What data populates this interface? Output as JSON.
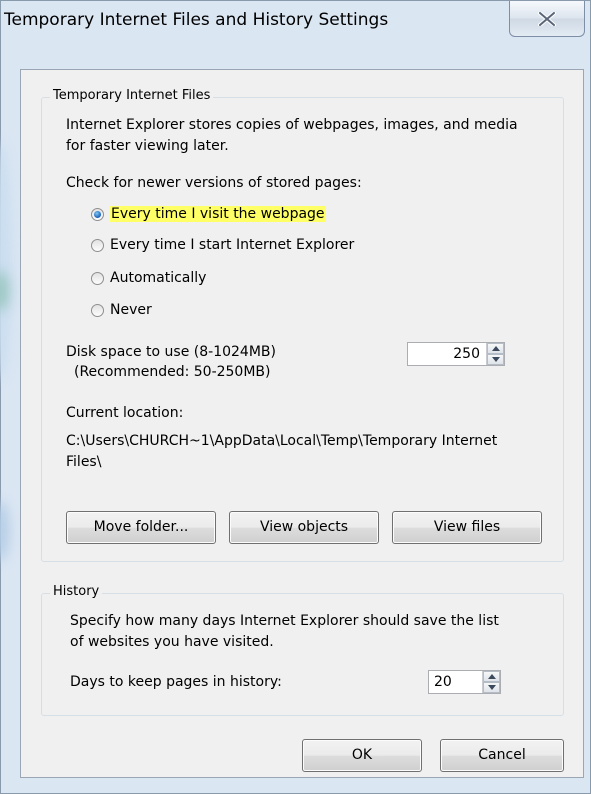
{
  "window": {
    "title": "Temporary Internet Files and History Settings"
  },
  "icons": {
    "close": "close-x-icon",
    "spin_up": "arrow-up-icon",
    "spin_down": "arrow-down-icon"
  },
  "colors": {
    "highlight": "#ffff66",
    "radio_selected": "#1a5fb4"
  },
  "temp_files": {
    "group_title": "Temporary Internet Files",
    "description_line1": "Internet Explorer stores copies of webpages, images, and media",
    "description_line2": "for faster viewing later.",
    "check_label": "Check for newer versions of stored pages:",
    "options": [
      {
        "label": "Every time I visit the webpage",
        "selected": true
      },
      {
        "label": "Every time I start Internet Explorer",
        "selected": false
      },
      {
        "label": "Automatically",
        "selected": false
      },
      {
        "label": "Never",
        "selected": false
      }
    ],
    "disk_label_line1": "Disk space to use (8-1024MB)",
    "disk_label_line2": "(Recommended: 50-250MB)",
    "disk_value": "250",
    "location_label": "Current location:",
    "location_path_line1": "C:\\Users\\CHURCH~1\\AppData\\Local\\Temp\\Temporary Internet",
    "location_path_line2": "Files\\",
    "buttons": {
      "move": "Move folder...",
      "objects": "View objects",
      "files": "View files"
    }
  },
  "history": {
    "group_title": "History",
    "description_line1": "Specify how many days Internet Explorer should save the list",
    "description_line2": "of websites you have visited.",
    "days_label": "Days to keep pages in history:",
    "days_value": "20"
  },
  "footer": {
    "ok": "OK",
    "cancel": "Cancel"
  }
}
